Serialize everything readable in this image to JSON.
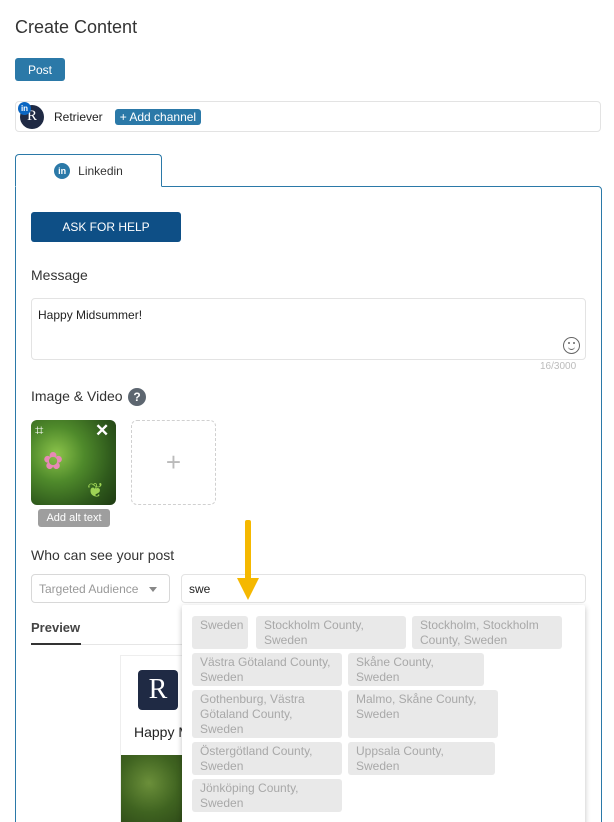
{
  "page": {
    "title": "Create Content"
  },
  "post_button": "Post",
  "channel_bar": {
    "channel_name": "Retriever",
    "add_channel_label": "+ Add channel",
    "badge_letters": "in",
    "avatar_letter": "R"
  },
  "tab": {
    "label": "Linkedin",
    "icon_letters": "in"
  },
  "ask_button": "ASK FOR HELP",
  "message": {
    "label": "Message",
    "value": "Happy Midsummer!",
    "counter": "16/3000"
  },
  "media": {
    "label": "Image & Video",
    "help_glyph": "?",
    "alt_text_label": "Add alt text",
    "add_glyph": "+"
  },
  "audience": {
    "label": "Who can see your post",
    "select_value": "Targeted Audience",
    "location_value": "swe"
  },
  "preview": {
    "tab_label": "Preview",
    "text": "Happy Midsummer!",
    "avatar_letter": "R"
  },
  "suggestions": [
    "Sweden",
    "Stockholm County, Sweden",
    "Stockholm, Stockholm County, Sweden",
    "Västra Götaland County, Sweden",
    "Skåne County, Sweden",
    "Gothenburg, Västra Götaland County, Sweden",
    "Malmo, Skåne County, Sweden",
    "Östergötland County, Sweden",
    "Uppsala County, Sweden",
    "Jönköping County, Sweden"
  ],
  "colors": {
    "accent": "#2b79a8",
    "ask_button": "#0e4f86",
    "arrow": "#f5b800"
  }
}
